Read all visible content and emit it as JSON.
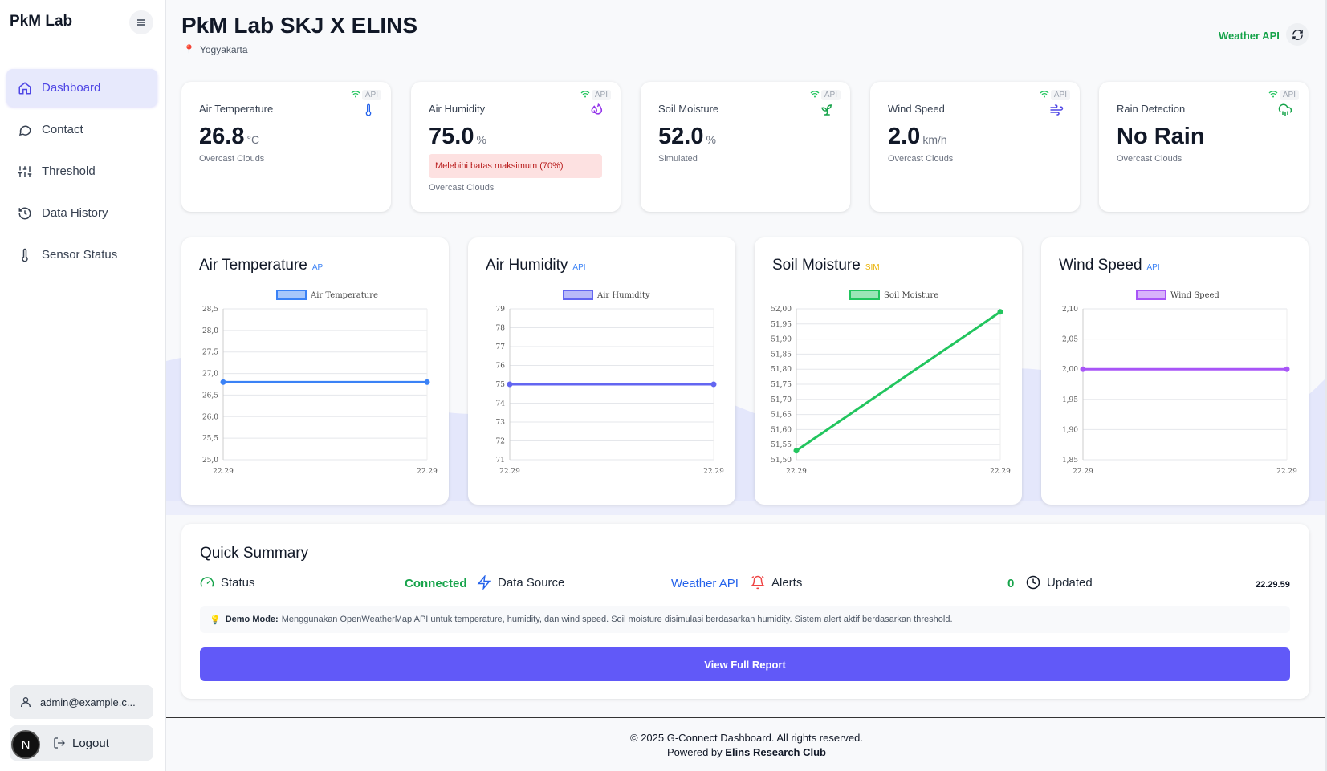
{
  "sidebar": {
    "brand": "PkM Lab",
    "items": [
      {
        "label": "Dashboard",
        "icon": "home-icon",
        "active": true
      },
      {
        "label": "Contact",
        "icon": "chat-icon"
      },
      {
        "label": "Threshold",
        "icon": "sliders-icon"
      },
      {
        "label": "Data History",
        "icon": "history-icon"
      },
      {
        "label": "Sensor Status",
        "icon": "thermometer-icon"
      }
    ],
    "user_email": "admin@example.c...",
    "logout_label": "Logout",
    "avatar_letter": "N"
  },
  "header": {
    "title": "PkM Lab SKJ X ELINS",
    "location": "Yogyakarta",
    "source_label": "Weather API"
  },
  "stats": [
    {
      "label": "Air Temperature",
      "value": "26.8",
      "unit": "°C",
      "sub": "Overcast Clouds",
      "tag": "API",
      "icon": "thermometer-icon",
      "icon_color": "#2563eb"
    },
    {
      "label": "Air Humidity",
      "value": "75.0",
      "unit": "%",
      "alert": "Melebihi batas maksimum (70%)",
      "sub": "Overcast Clouds",
      "tag": "API",
      "icon": "droplets-icon",
      "icon_color": "#9333ea"
    },
    {
      "label": "Soil Moisture",
      "value": "52.0",
      "unit": "%",
      "sub": "Simulated",
      "tag": "API",
      "icon": "sprout-icon",
      "icon_color": "#16a34a"
    },
    {
      "label": "Wind Speed",
      "value": "2.0",
      "unit": "km/h",
      "sub": "Overcast Clouds",
      "tag": "API",
      "icon": "wind-icon",
      "icon_color": "#4f46e5"
    },
    {
      "label": "Rain Detection",
      "value": "No Rain",
      "unit": "",
      "sub": "Overcast Clouds",
      "tag": "API",
      "icon": "cloud-rain-icon",
      "icon_color": "#16a34a"
    }
  ],
  "colors": {
    "accent": "#6159f8",
    "temp": "#3b82f6",
    "humidity": "#6366f1",
    "soil": "#22c55e",
    "wind": "#a855f7",
    "connected": "#16a34a",
    "link": "#2563eb"
  },
  "chart_data": [
    {
      "type": "line",
      "title": "Air Temperature",
      "tag": "API",
      "categories": [
        "22.29",
        "22.29"
      ],
      "series": [
        {
          "name": "Air Temperature",
          "values": [
            26.8,
            26.8
          ]
        }
      ],
      "yticks": [
        "28,5",
        "28,0",
        "27,5",
        "27,0",
        "26,5",
        "26,0",
        "25,5",
        "25,0"
      ],
      "ylim": [
        25.0,
        28.5
      ],
      "grid": true,
      "legend": "top"
    },
    {
      "type": "line",
      "title": "Air Humidity",
      "tag": "API",
      "categories": [
        "22.29",
        "22.29"
      ],
      "series": [
        {
          "name": "Air Humidity",
          "values": [
            75,
            75
          ]
        }
      ],
      "yticks": [
        "79",
        "78",
        "77",
        "76",
        "75",
        "74",
        "73",
        "72",
        "71"
      ],
      "ylim": [
        71,
        79
      ],
      "grid": true,
      "legend": "top"
    },
    {
      "type": "line",
      "title": "Soil Moisture",
      "tag": "SIM",
      "categories": [
        "22.29",
        "22.29"
      ],
      "series": [
        {
          "name": "Soil Moisture",
          "values": [
            51.53,
            51.99
          ]
        }
      ],
      "yticks": [
        "52,00",
        "51,95",
        "51,90",
        "51,85",
        "51,80",
        "51,75",
        "51,70",
        "51,65",
        "51,60",
        "51,55",
        "51,50"
      ],
      "ylim": [
        51.5,
        52.0
      ],
      "grid": true,
      "legend": "top"
    },
    {
      "type": "line",
      "title": "Wind Speed",
      "tag": "API",
      "categories": [
        "22.29",
        "22.29"
      ],
      "series": [
        {
          "name": "Wind Speed",
          "values": [
            2.0,
            2.0
          ]
        }
      ],
      "yticks": [
        "2,10",
        "2,05",
        "2,00",
        "1,95",
        "1,90",
        "1,85"
      ],
      "ylim": [
        1.85,
        2.1
      ],
      "grid": true,
      "legend": "top"
    }
  ],
  "summary": {
    "title": "Quick Summary",
    "status_label": "Status",
    "status_value": "Connected",
    "source_label": "Data Source",
    "source_value": "Weather API",
    "alerts_label": "Alerts",
    "alerts_value": "0",
    "updated_label": "Updated",
    "updated_value": "22.29.59",
    "demo_title": "Demo Mode:",
    "demo_text": "Menggunakan OpenWeatherMap API untuk temperature, humidity, dan wind speed. Soil moisture disimulasi berdasarkan humidity. Sistem alert aktif berdasarkan threshold.",
    "button_label": "View Full Report"
  },
  "footer": {
    "copyright": "© 2025 G-Connect Dashboard. All rights reserved.",
    "powered_prefix": "Powered by",
    "powered_by": "Elins Research Club"
  }
}
